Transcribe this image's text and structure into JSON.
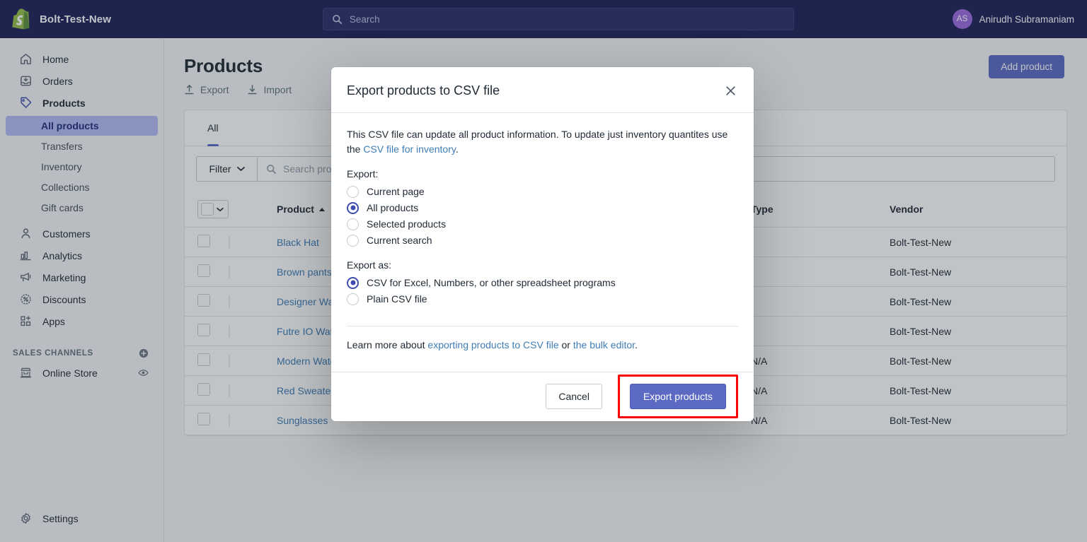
{
  "topbar": {
    "brand_name": "Bolt-Test-New",
    "logo_icon": "shopify-bag-icon",
    "search": {
      "icon": "search-icon",
      "placeholder": "Search",
      "value": ""
    },
    "account": {
      "initials": "AS",
      "name": "Anirudh Subramaniam"
    }
  },
  "sidebar": {
    "items": [
      {
        "label": "Home",
        "icon": "home-icon"
      },
      {
        "label": "Orders",
        "icon": "orders-inbox-icon"
      },
      {
        "label": "Products",
        "icon": "products-tag-icon"
      }
    ],
    "products_subnav": [
      {
        "label": "All products",
        "active": true
      },
      {
        "label": "Transfers",
        "active": false
      },
      {
        "label": "Inventory",
        "active": false
      },
      {
        "label": "Collections",
        "active": false
      },
      {
        "label": "Gift cards",
        "active": false
      }
    ],
    "items_lower": [
      {
        "label": "Customers",
        "icon": "customers-person-icon"
      },
      {
        "label": "Analytics",
        "icon": "analytics-bars-icon"
      },
      {
        "label": "Marketing",
        "icon": "marketing-megaphone-icon"
      },
      {
        "label": "Discounts",
        "icon": "discounts-percent-badge-icon"
      },
      {
        "label": "Apps",
        "icon": "apps-grid-plus-icon"
      }
    ],
    "sales_channels": {
      "title": "SALES CHANNELS",
      "add_icon": "plus-circle-icon",
      "items": [
        {
          "label": "Online Store",
          "icon": "storefront-icon",
          "trailing_icon": "eye-icon"
        }
      ]
    },
    "settings": {
      "label": "Settings",
      "icon": "gear-icon"
    }
  },
  "page": {
    "title": "Products",
    "toolbar": [
      {
        "label": "Export",
        "icon": "upload-arrow-icon"
      },
      {
        "label": "Import",
        "icon": "download-arrow-icon"
      }
    ],
    "add_product_label": "Add product"
  },
  "card": {
    "tabs": [
      {
        "label": "All",
        "active": true
      }
    ],
    "filter": {
      "button_label": "Filter",
      "caret_icon": "chevron-down-icon",
      "search_icon": "search-icon",
      "placeholder": "Search products",
      "value": ""
    },
    "table": {
      "select_all": {
        "checkbox_icon": "checkbox-icon",
        "caret_icon": "chevron-down-icon"
      },
      "columns": [
        "",
        "",
        "Product",
        "Type",
        "Vendor"
      ],
      "sort_column": "Product",
      "sort_icon": "caret-up-icon",
      "rows": [
        {
          "name": "Black Hat",
          "type": "",
          "vendor": "Bolt-Test-New",
          "thumb": "woman-black-hat-photo"
        },
        {
          "name": "Brown pants",
          "type": "",
          "vendor": "Bolt-Test-New",
          "thumb": "brown-pants-photo"
        },
        {
          "name": "Designer Watch",
          "type": "",
          "vendor": "Bolt-Test-New",
          "thumb": "dark-watch-photo"
        },
        {
          "name": "Futre IO Watch",
          "type": "",
          "vendor": "Bolt-Test-New",
          "thumb": "futuristic-watch-photo"
        },
        {
          "name": "Modern Watch Design",
          "type": "N/A",
          "vendor": "Bolt-Test-New",
          "thumb": "modern-watch-photo"
        },
        {
          "name": "Red Sweater",
          "type": "N/A",
          "vendor": "Bolt-Test-New",
          "thumb": "red-sweater-photo"
        },
        {
          "name": "Sunglasses",
          "type": "N/A",
          "vendor": "Bolt-Test-New",
          "thumb": "sunglasses-photo"
        }
      ]
    }
  },
  "modal": {
    "title": "Export products to CSV file",
    "close_icon": "close-x-icon",
    "description_part1": "This CSV file can update all product information. To update just inventory quantites use the ",
    "description_link": "CSV file for inventory",
    "description_part2": ".",
    "export_group_label": "Export:",
    "export_options": [
      {
        "label": "Current page",
        "selected": false
      },
      {
        "label": "All products",
        "selected": true
      },
      {
        "label": "Selected products",
        "selected": false
      },
      {
        "label": "Current search",
        "selected": false
      }
    ],
    "export_as_group_label": "Export as:",
    "export_as_options": [
      {
        "label": "CSV for Excel, Numbers, or other spreadsheet programs",
        "selected": true
      },
      {
        "label": "Plain CSV file",
        "selected": false
      }
    ],
    "learn_prefix": "Learn more about ",
    "learn_link1": "exporting products to CSV file",
    "learn_mid": " or ",
    "learn_link2": "the bulk editor",
    "learn_suffix": ".",
    "cancel_label": "Cancel",
    "export_label": "Export products",
    "highlight_color": "#ff0000"
  },
  "colors": {
    "topbar_bg": "#1f2259",
    "accent": "#5c6ac4",
    "link": "#3f7cb5",
    "active_subnav_bg": "#b3bcf5",
    "avatar_bg": "#9c6ade"
  }
}
